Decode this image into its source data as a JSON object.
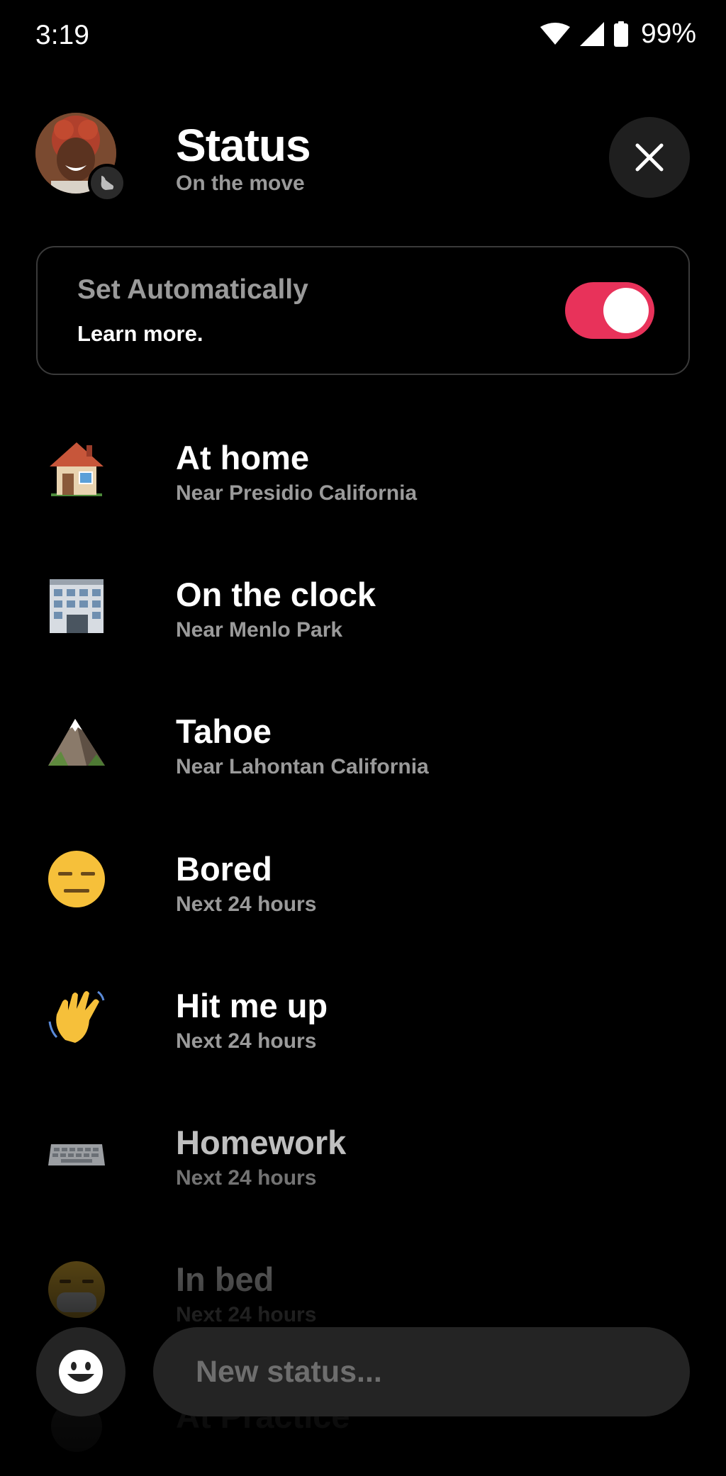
{
  "status_bar": {
    "time": "3:19",
    "battery": "99%",
    "icons": [
      "wifi-icon",
      "cellular-signal-icon",
      "battery-icon"
    ]
  },
  "header": {
    "title": "Status",
    "subtitle": "On the move",
    "avatar_badge_icon": "sneaker-icon",
    "close_icon": "close-icon"
  },
  "auto": {
    "title": "Set Automatically",
    "link": "Learn more.",
    "toggle_on": true,
    "toggle_color": "#e8325a"
  },
  "statuses": [
    {
      "emoji": "house-icon",
      "title": "At home",
      "subtitle": "Near Presidio California"
    },
    {
      "emoji": "office-building-icon",
      "title": "On the clock",
      "subtitle": "Near Menlo Park"
    },
    {
      "emoji": "mountain-icon",
      "title": "Tahoe",
      "subtitle": "Near Lahontan California"
    },
    {
      "emoji": "expressionless-face-icon",
      "title": "Bored",
      "subtitle": "Next 24 hours"
    },
    {
      "emoji": "waving-hand-icon",
      "title": "Hit me up",
      "subtitle": "Next 24 hours"
    },
    {
      "emoji": "keyboard-icon",
      "title": "Homework",
      "subtitle": "Next 24 hours"
    },
    {
      "emoji": "face-with-mask-icon",
      "title": "In bed",
      "subtitle": "Next 24 hours"
    },
    {
      "emoji": "generic-status-icon",
      "title": "At Practice",
      "subtitle": ""
    }
  ],
  "composer": {
    "placeholder": "New status...",
    "emoji_button_icon": "smiley-face-icon"
  }
}
